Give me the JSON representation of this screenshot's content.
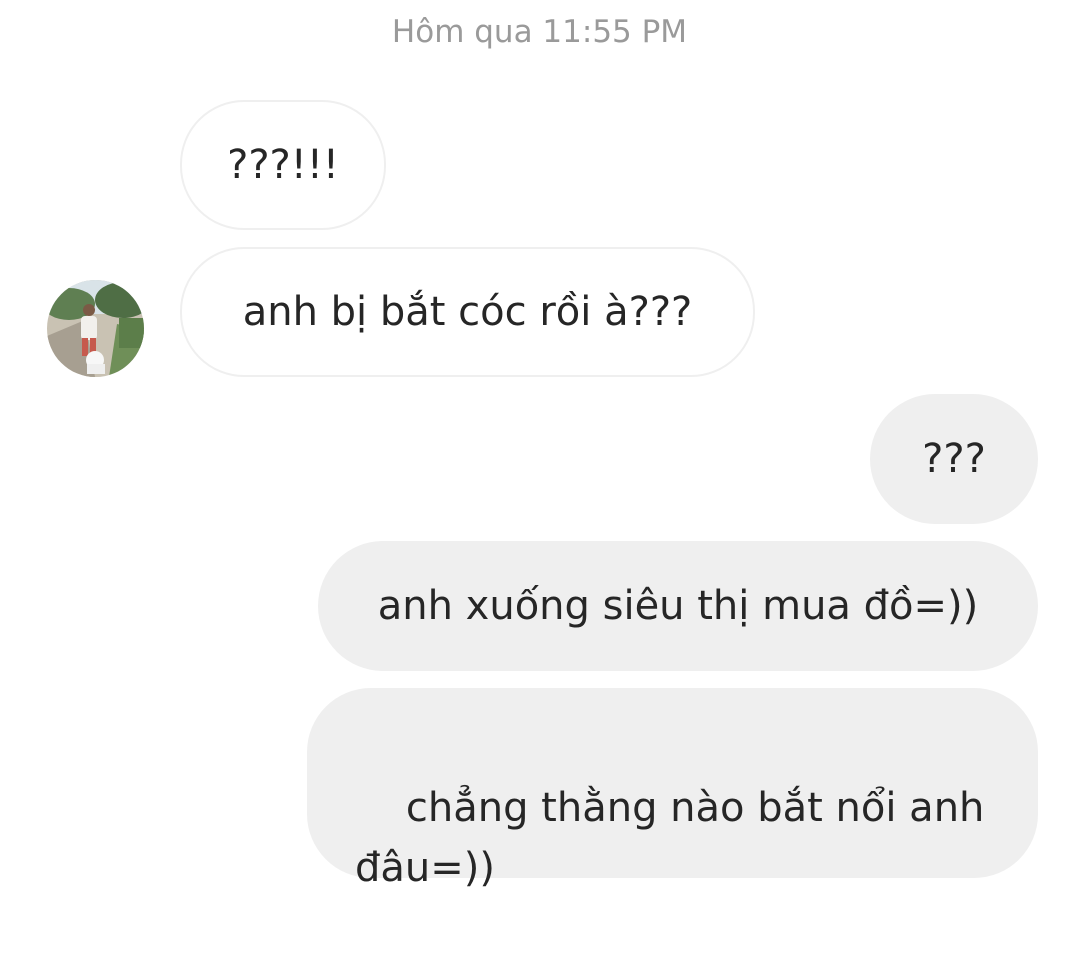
{
  "chat": {
    "timestamp": "Hôm qua 11:55 PM",
    "messages": [
      {
        "direction": "incoming",
        "text": "???!!!"
      },
      {
        "direction": "incoming",
        "text": "anh bị bắt cóc rồi à???"
      },
      {
        "direction": "outgoing",
        "text": "???"
      },
      {
        "direction": "outgoing",
        "text": "anh xuống siêu thị mua đồ=))"
      },
      {
        "direction": "outgoing",
        "text": "chẳng thằng nào bắt nổi anh\nđâu=))"
      }
    ]
  },
  "colors": {
    "incoming_bubble": "#ffffff",
    "incoming_border": "#efefef",
    "outgoing_bubble": "#efefef",
    "message_text": "#262626",
    "timestamp_text": "#9a9a9a"
  },
  "icons": {
    "avatar": "contact-avatar-photo"
  }
}
